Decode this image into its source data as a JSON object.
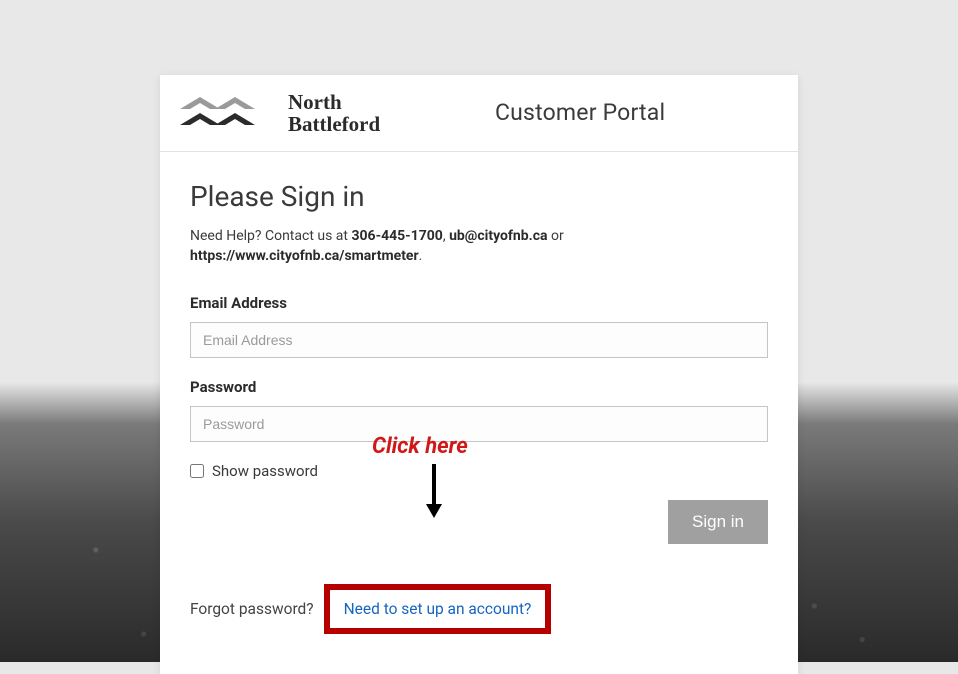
{
  "header": {
    "logo_brand_line1": "North",
    "logo_brand_line2": "Battleford",
    "portal_title": "Customer Portal"
  },
  "signin": {
    "heading": "Please Sign in",
    "help_prefix": "Need Help? Contact us at ",
    "help_phone": "306-445-1700",
    "help_sep1": ", ",
    "help_email": "ub@cityofnb.ca",
    "help_sep2": " or ",
    "help_url": "https://www.cityofnb.ca/smartmeter",
    "help_period": ".",
    "email_label": "Email Address",
    "email_placeholder": "Email Address",
    "password_label": "Password",
    "password_placeholder": "Password",
    "show_password_label": "Show password",
    "signin_button": "Sign in",
    "forgot_link": "Forgot password?",
    "setup_link": "Need to set up an account?"
  },
  "annotation": {
    "click_here": "Click here"
  }
}
